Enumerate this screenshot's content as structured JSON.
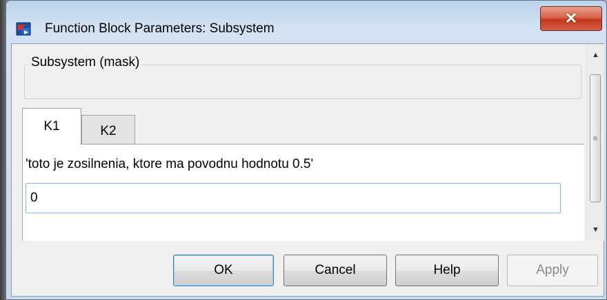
{
  "window": {
    "title": "Function Block Parameters: Subsystem",
    "close_label": "✕"
  },
  "group": {
    "legend": "Subsystem (mask)"
  },
  "tabs": [
    {
      "label": "K1",
      "selected": true
    },
    {
      "label": "K2",
      "selected": false
    }
  ],
  "parameter": {
    "label": "'toto je zosilnenia, ktore ma povodnu hodnotu 0.5'",
    "value": "0"
  },
  "buttons": {
    "ok": "OK",
    "cancel": "Cancel",
    "help": "Help",
    "apply": "Apply"
  },
  "scrollbar": {
    "up_icon": "▲",
    "down_icon": "▼",
    "grip_icon": "≡"
  },
  "colors": {
    "close_button": "#c3381b",
    "focus_border": "#7eb4ea",
    "default_button_border": "#3c7fb1"
  }
}
